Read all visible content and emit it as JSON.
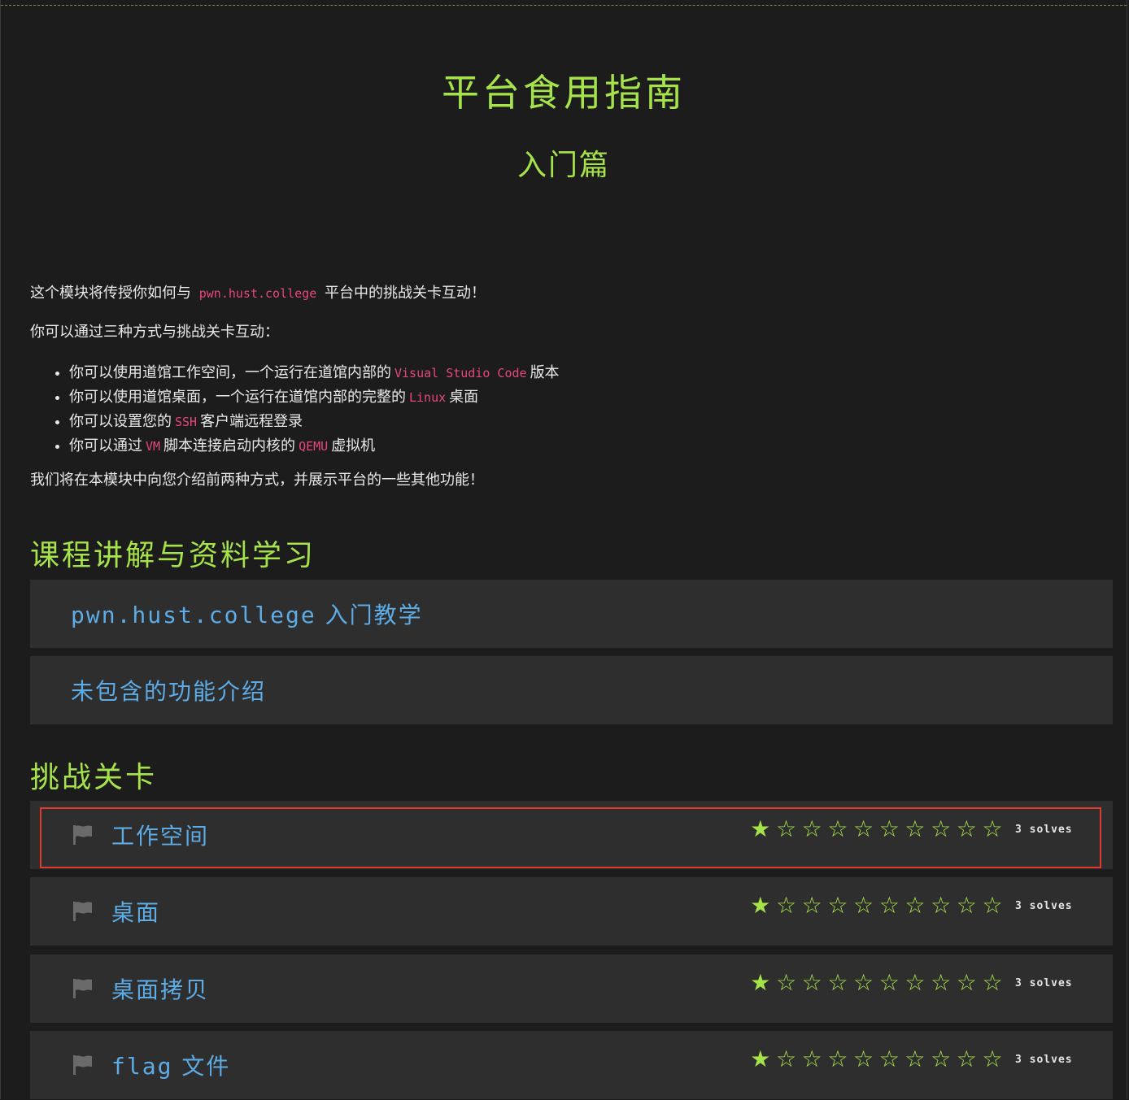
{
  "header": {
    "title": "平台食用指南",
    "subtitle": "入门篇"
  },
  "intro": {
    "line1_pre": "这个模块将传授你如何与",
    "line1_code": "pwn.hust.college",
    "line1_post": "平台中的挑战关卡互动！",
    "line2": "你可以通过三种方式与挑战关卡互动：",
    "bullets": [
      {
        "pre": "你可以使用道馆工作空间，一个运行在道馆内部的",
        "code": "Visual Studio Code",
        "post": "版本"
      },
      {
        "pre": "你可以使用道馆桌面，一个运行在道馆内部的完整的",
        "code": "Linux",
        "post": "桌面"
      },
      {
        "pre": "你可以设置您的",
        "code": "SSH",
        "post": "客户端远程登录"
      },
      {
        "pre": "你可以通过",
        "code": "VM",
        "post": "脚本连接启动内核的",
        "code2": "QEMU",
        "post2": "虚拟机"
      }
    ],
    "line3": "我们将在本模块中向您介绍前两种方式，并展示平台的一些其他功能！"
  },
  "lectures": {
    "heading": "课程讲解与资料学习",
    "items": [
      {
        "label_mono": "pwn.hust.college",
        "label": "入门教学"
      },
      {
        "label": "未包含的功能介绍"
      }
    ]
  },
  "challenges": {
    "heading": "挑战关卡",
    "items": [
      {
        "title": "工作空间",
        "rating": 1,
        "max_rating": 10,
        "solves": "3 solves"
      },
      {
        "title": "桌面",
        "rating": 1,
        "max_rating": 10,
        "solves": "3 solves"
      },
      {
        "title": "桌面拷贝",
        "rating": 1,
        "max_rating": 10,
        "solves": "3 solves"
      },
      {
        "title_mono": "flag",
        "title": "文件",
        "rating": 1,
        "max_rating": 10,
        "solves": "3 solves"
      }
    ],
    "flag_icon": "flag-icon",
    "star_filled": "★",
    "star_empty": "☆"
  },
  "colors": {
    "accent_green": "#a6e34a",
    "link_blue": "#5dace6",
    "code_pink": "#e8477c",
    "highlight_red": "#e23a2a"
  }
}
